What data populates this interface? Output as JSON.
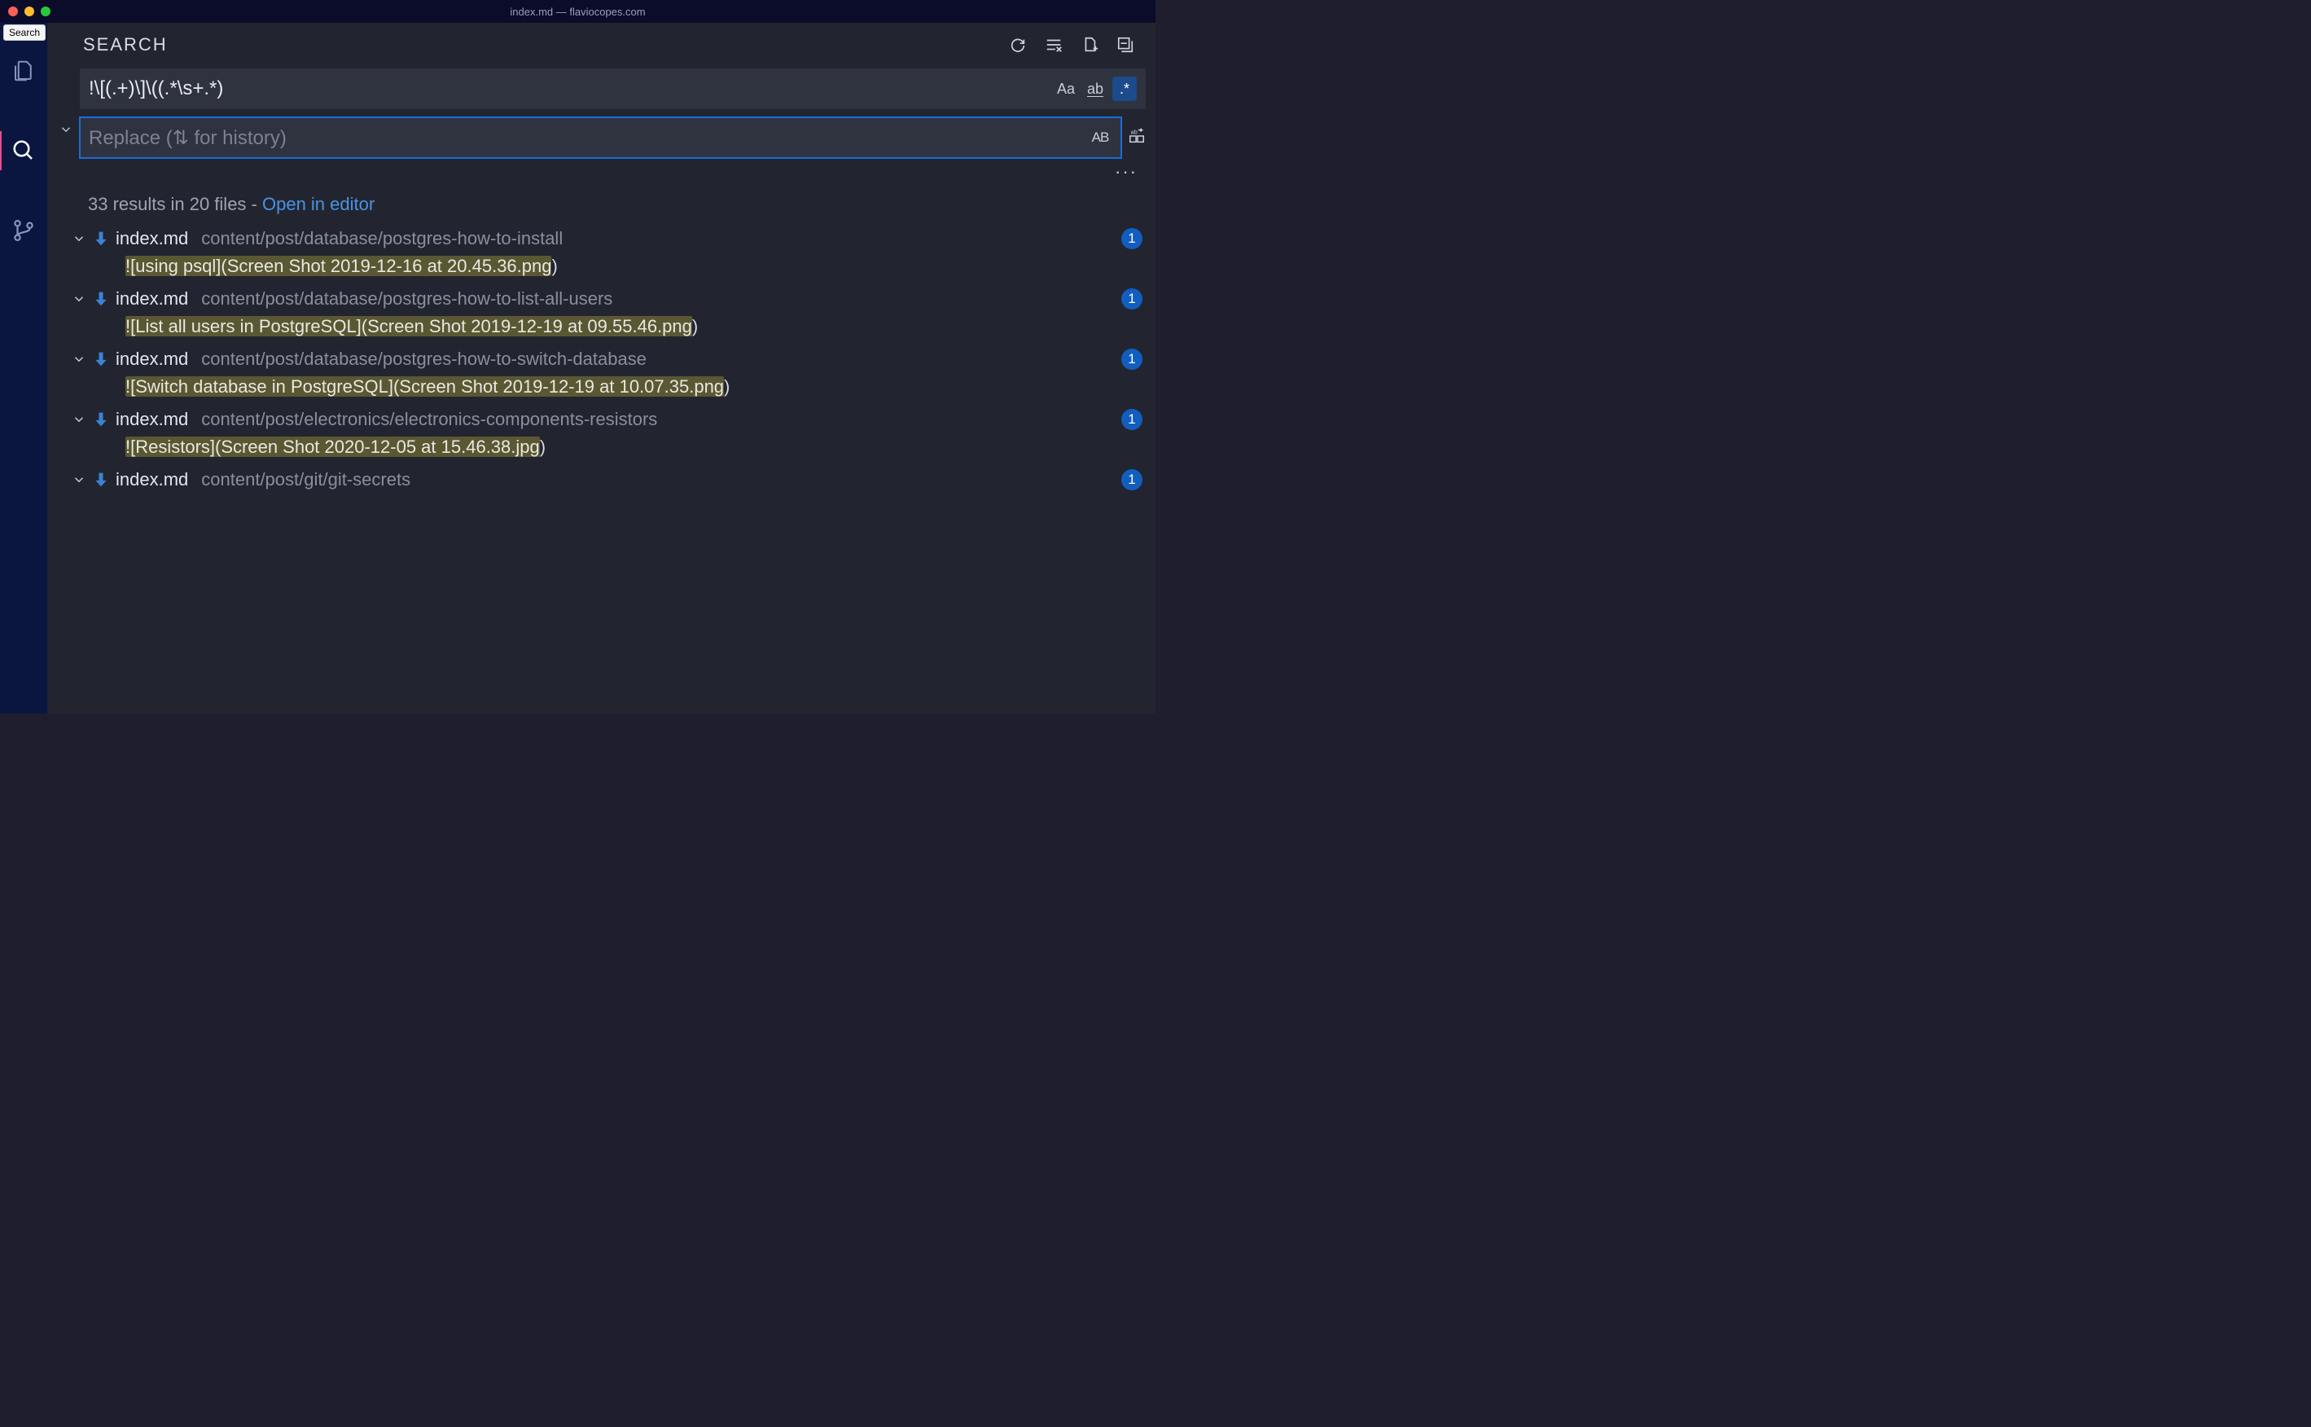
{
  "window_title": "index.md — flaviocopes.com",
  "tooltip": "Search",
  "panel": {
    "title": "SEARCH"
  },
  "search": {
    "value": "!\\[(.+)\\]\\((.*\\s+.*)",
    "match_case_label": "Aa",
    "whole_word_label": "ab",
    "regex_label": ".*"
  },
  "replace": {
    "placeholder": "Replace (⇅ for history)",
    "preserve_case_label": "AB"
  },
  "summary": {
    "text": "33 results in 20 files - ",
    "link": "Open in editor"
  },
  "results": [
    {
      "filename": "index.md",
      "path": "content/post/database/postgres-how-to-install",
      "count": "1",
      "match_hl": "![using psql](Screen Shot 2019-12-16 at 20.45.36.png",
      "match_rest": ")"
    },
    {
      "filename": "index.md",
      "path": "content/post/database/postgres-how-to-list-all-users",
      "count": "1",
      "match_hl": "![List all users in PostgreSQL](Screen Shot 2019-12-19 at 09.55.46.png",
      "match_rest": ")"
    },
    {
      "filename": "index.md",
      "path": "content/post/database/postgres-how-to-switch-database",
      "count": "1",
      "match_hl": "![Switch database in PostgreSQL](Screen Shot 2019-12-19 at 10.07.35.png",
      "match_rest": ")"
    },
    {
      "filename": "index.md",
      "path": "content/post/electronics/electronics-components-resistors",
      "count": "1",
      "match_hl": "![Resistors](Screen Shot 2020-12-05 at 15.46.38.jpg",
      "match_rest": ")"
    },
    {
      "filename": "index.md",
      "path": "content/post/git/git-secrets",
      "count": "1",
      "match_hl": "",
      "match_rest": ""
    }
  ]
}
